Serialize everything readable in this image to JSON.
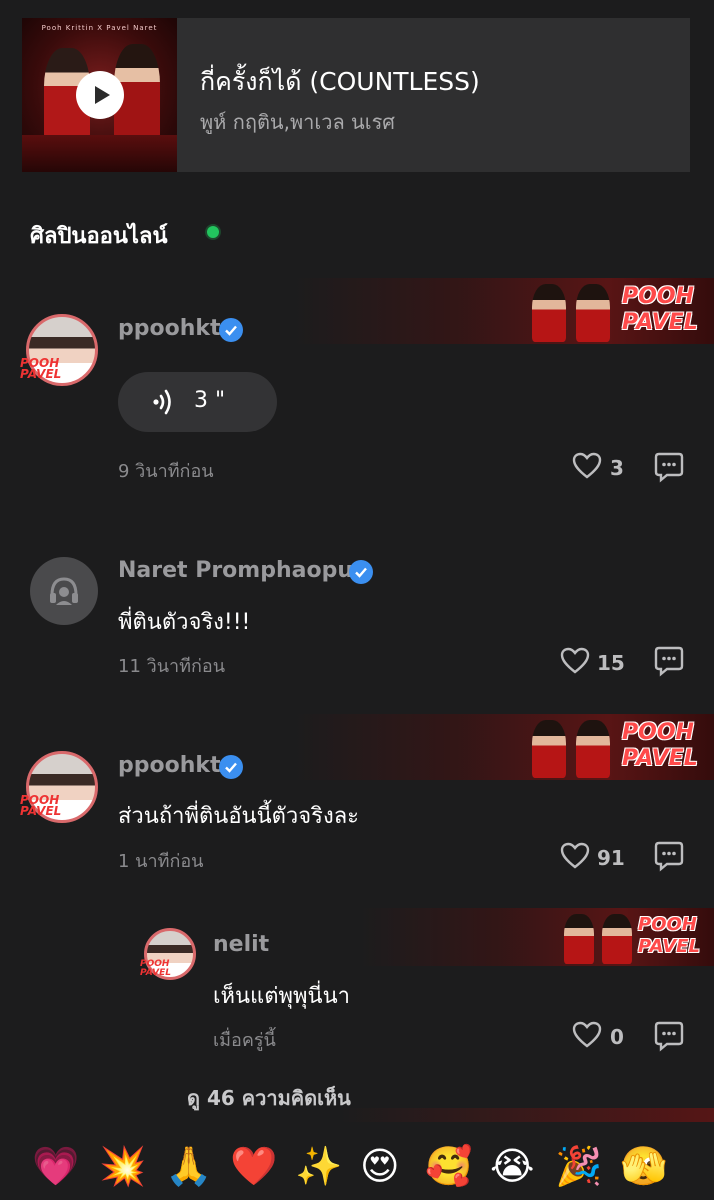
{
  "track": {
    "art_caption": "Pooh Krittin  X  Pavel Naret",
    "title": "กี่ครั้งก็ได้ (COUNTLESS)",
    "artist": "พูห์ กฤติน,พาเวล นเรศ"
  },
  "section": {
    "title": "ศิลปินออนไลน์"
  },
  "comments": [
    {
      "username": "ppoohkt",
      "verified": true,
      "voice_duration": "3 \"",
      "timestamp": "9 วินาทีก่อน",
      "likes": "3",
      "banner_brand": "POOH PAVEL",
      "avatar_deco": "POOH PAVEL"
    },
    {
      "username": "Naret Promphaopun",
      "verified": true,
      "text": "พี่ตินตัวจริง!!!",
      "timestamp": "11 วินาทีก่อน",
      "likes": "15"
    },
    {
      "username": "ppoohkt",
      "verified": true,
      "text": "ส่วนถ้าพี่ตินอันนี้ตัวจริงละ",
      "timestamp": "1 นาทีก่อน",
      "likes": "91",
      "banner_brand": "POOH PAVEL",
      "avatar_deco": "POOH PAVEL"
    },
    {
      "username": "nelit",
      "verified": false,
      "text": "เห็นแต่พุพุนี่นา",
      "timestamp": "เมื่อครู่นี้",
      "likes": "0",
      "banner_brand": "POOH PAVEL",
      "avatar_deco": "POOH PAVEL"
    }
  ],
  "see_more": "ดู 46 ความคิดเห็น",
  "reactions": [
    "💗",
    "💥",
    "🙏",
    "❤️",
    "✨",
    "😍",
    "🥰",
    "😭",
    "🎉",
    "🫣"
  ],
  "colors": {
    "background": "#1c1c1d",
    "card": "#2f2f30",
    "verified": "#3b8ff0",
    "online": "#22c55e",
    "brand": "#ff4a4a"
  },
  "icons": [
    "play-icon",
    "voice-wave-icon",
    "verified-icon",
    "heart-icon",
    "reply-bubble-icon",
    "default-avatar-icon"
  ]
}
